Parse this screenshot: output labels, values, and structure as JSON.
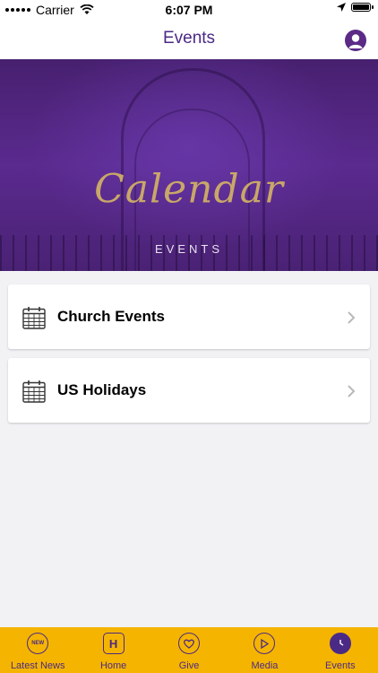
{
  "status_bar": {
    "carrier": "Carrier",
    "time": "6:07 PM"
  },
  "nav": {
    "title": "Events"
  },
  "banner": {
    "title": "Calendar",
    "subtitle": "EVENTS"
  },
  "list": [
    {
      "label": "Church Events",
      "icon": "calendar-icon"
    },
    {
      "label": "US Holidays",
      "icon": "calendar-icon"
    }
  ],
  "tabs": [
    {
      "label": "Latest News",
      "icon": "new-badge-icon",
      "icon_text": "NEW",
      "active": false
    },
    {
      "label": "Home",
      "icon": "home-icon",
      "icon_text": "H",
      "active": false
    },
    {
      "label": "Give",
      "icon": "heart-icon",
      "active": false
    },
    {
      "label": "Media",
      "icon": "play-icon",
      "active": false
    },
    {
      "label": "Events",
      "icon": "clock-icon",
      "active": true
    }
  ],
  "colors": {
    "accent": "#4b2a86",
    "tab_bar": "#f5b400",
    "banner_text": "#c9a768"
  }
}
